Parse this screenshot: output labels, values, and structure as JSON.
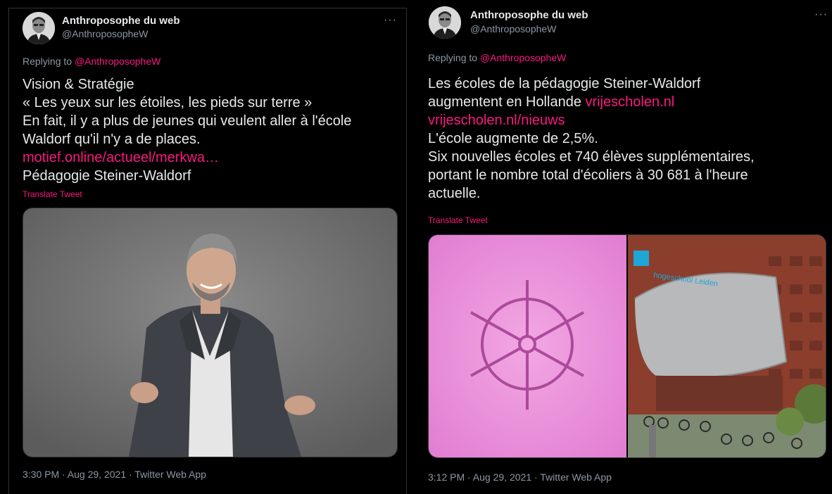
{
  "tweets": [
    {
      "author_name": "Anthroposophe du web",
      "author_handle": "@AnthroposopheW",
      "more_label": "···",
      "replying_prefix": "Replying to",
      "replying_mention": "@AnthroposopheW",
      "lines": [
        "Vision & Stratégie",
        "« Les yeux sur les étoiles, les pieds sur terre »",
        "En fait, il y a plus de jeunes qui veulent aller à l'école",
        "Waldorf qu'il n'y a de places."
      ],
      "link": "motief.online/actueel/merkwa…",
      "after_link": "Pédagogie Steiner-Waldorf",
      "translate_label": "Translate Tweet",
      "timestamp": "3:30 PM · Aug 29, 2021 · Twitter Web App"
    },
    {
      "author_name": "Anthroposophe du web",
      "author_handle": "@AnthroposopheW",
      "more_label": "···",
      "replying_prefix": "Replying to",
      "replying_mention": "@AnthroposopheW",
      "line1": "Les écoles de la pédagogie Steiner-Waldorf",
      "line2_text": "augmentent en Hollande",
      "link1": "vrijescholen.nl",
      "link2": "vrijescholen.nl/nieuws",
      "lines": [
        "L'école augmente de 2,5%.",
        "Six nouvelles écoles et 740 élèves supplémentaires,",
        "portant le nombre total d'écoliers à 30 681 à l'heure",
        "actuelle."
      ],
      "translate_label": "Translate Tweet",
      "building_sign": "hogeschool Leiden",
      "timestamp": "3:12 PM · Aug 29, 2021 · Twitter Web App"
    }
  ],
  "colors": {
    "link": "#f91880",
    "secondary_text": "#8b98a5",
    "primary_text": "#e7e9ea",
    "background": "#000000"
  }
}
